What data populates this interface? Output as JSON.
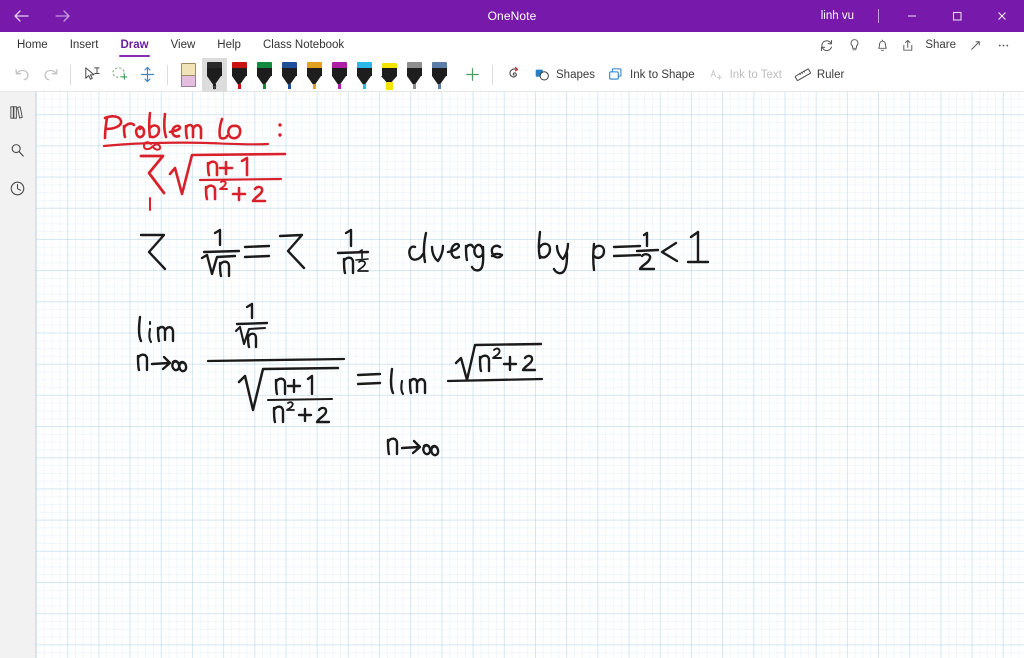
{
  "titlebar": {
    "app_title": "OneNote",
    "user": "linh vu",
    "back_icon": "back-arrow-icon",
    "forward_icon": "forward-arrow-icon",
    "minimize_label": "–",
    "restore_label": "❐",
    "close_label": "✕",
    "accent_color": "#7719aa"
  },
  "ribbon": {
    "tabs": [
      {
        "label": "Home",
        "active": false
      },
      {
        "label": "Insert",
        "active": false
      },
      {
        "label": "Draw",
        "active": true
      },
      {
        "label": "View",
        "active": false
      },
      {
        "label": "Help",
        "active": false
      },
      {
        "label": "Class Notebook",
        "active": false
      }
    ],
    "actions": [
      {
        "name": "sync-icon",
        "label": ""
      },
      {
        "name": "lightbulb-icon",
        "label": ""
      },
      {
        "name": "bell-icon",
        "label": ""
      },
      {
        "name": "share-icon",
        "label": "Share"
      },
      {
        "name": "expand-icon",
        "label": ""
      },
      {
        "name": "more-options-icon",
        "label": "•••"
      }
    ],
    "share_label": "Share"
  },
  "toolbar": {
    "undo_label": "Undo",
    "redo_label": "Redo",
    "select_label": "Select",
    "lasso_label": "Lasso Select",
    "space_label": "Insert Space",
    "eraser_label": "Eraser",
    "add_pen_label": "+",
    "replay_label": "Ink Replay",
    "shapes_label": "Shapes",
    "ink_to_shape_label": "Ink to Shape",
    "ink_to_text_label": "Ink to Text",
    "ruler_label": "Ruler",
    "pens": [
      {
        "name": "pen-black",
        "color": "#1d1d1d",
        "cap": "#2b2b2b",
        "selected": true,
        "type": "pen"
      },
      {
        "name": "pen-red",
        "color": "#cc1111",
        "cap": "#cc1111",
        "selected": false,
        "type": "pen"
      },
      {
        "name": "pen-green",
        "color": "#128a3e",
        "cap": "#128a3e",
        "selected": false,
        "type": "pen"
      },
      {
        "name": "pen-blue",
        "color": "#1f4e9c",
        "cap": "#1f4e9c",
        "selected": false,
        "type": "pen"
      },
      {
        "name": "pen-gold",
        "color": "#e0a020",
        "cap": "#e0a020",
        "selected": false,
        "type": "pen"
      },
      {
        "name": "pen-magenta",
        "color": "#b01fa8",
        "cap": "#b01fa8",
        "selected": false,
        "type": "pen"
      },
      {
        "name": "pen-cyan",
        "color": "#2bb8e6",
        "cap": "#2bb8e6",
        "selected": false,
        "type": "pen"
      },
      {
        "name": "highlighter-yellow",
        "color": "#f5e400",
        "cap": "#f5e400",
        "selected": false,
        "type": "highlighter"
      },
      {
        "name": "pen-grey",
        "color": "#8d8d8d",
        "cap": "#8d8d8d",
        "selected": false,
        "type": "pen"
      },
      {
        "name": "pen-steel",
        "color": "#5c7ea8",
        "cap": "#5c7ea8",
        "selected": false,
        "type": "pen"
      }
    ]
  },
  "sidebar": {
    "items": [
      {
        "name": "notebooks-icon",
        "label": "Notebooks"
      },
      {
        "name": "search-icon",
        "label": "Search"
      },
      {
        "name": "recent-notes-icon",
        "label": "Recent Notes"
      }
    ]
  },
  "page": {
    "ink_notes": [
      {
        "text": "Problem 6 :",
        "color": "#d8212b",
        "underlined": true
      },
      {
        "text": "Σ from 1 to ∞ of √((n+1)/(n²+2))",
        "color": "#d8212b",
        "underlined": false
      },
      {
        "text": "Σ 1/√n = Σ 1/n^(1/2)   diverges by p = 1/2 < 1",
        "color": "#1b1b1b",
        "underlined": false
      },
      {
        "text": "lim n→∞  (1/√n) / √((n+1)/(n²+2))  =  lim n→∞  √(n²+2)",
        "color": "#1b1b1b",
        "underlined": false
      }
    ],
    "grid_color": "#96c3e1",
    "background": "#ffffff"
  }
}
